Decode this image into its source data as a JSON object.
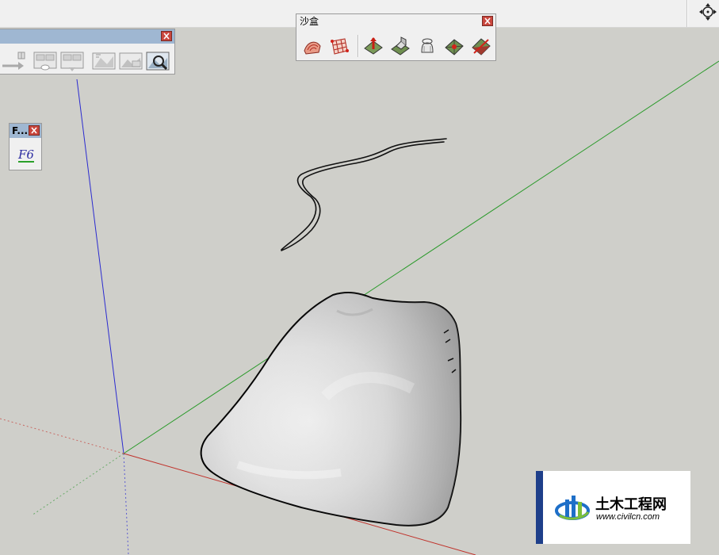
{
  "app": {
    "accent": "#9fb7d2",
    "background_color": "#cfcfca"
  },
  "top_bar": {
    "right_tool_icon": "orbit-icon"
  },
  "toolbars": {
    "sandbox": {
      "title": "沙盒",
      "close_icon": "close-icon",
      "tools": [
        "from-contours-icon",
        "from-scratch-icon",
        "smoove-icon",
        "stamp-icon",
        "drape-icon",
        "add-detail-icon",
        "flip-edge-icon"
      ]
    },
    "views": {
      "close_icon": "close-icon",
      "tools": [
        "previous-view-icon",
        "next-view-icon",
        "standard-view-icon",
        "iso-view-icon",
        "top-view-icon",
        "zoom-extents-icon"
      ]
    },
    "f6": {
      "title": "F...",
      "button_label": "F6",
      "close_icon": "close-icon"
    }
  },
  "scene": {
    "axes_colors": {
      "x_axis": "#c0322b",
      "y_axis": "#2a9a2a",
      "z_axis": "#2a2ad0"
    },
    "objects": [
      "path-curve",
      "terrain-mesh"
    ]
  },
  "watermark": {
    "name": "土木工程网",
    "url": "www.civilcn.com",
    "bar_color": "#1e3f8a"
  }
}
